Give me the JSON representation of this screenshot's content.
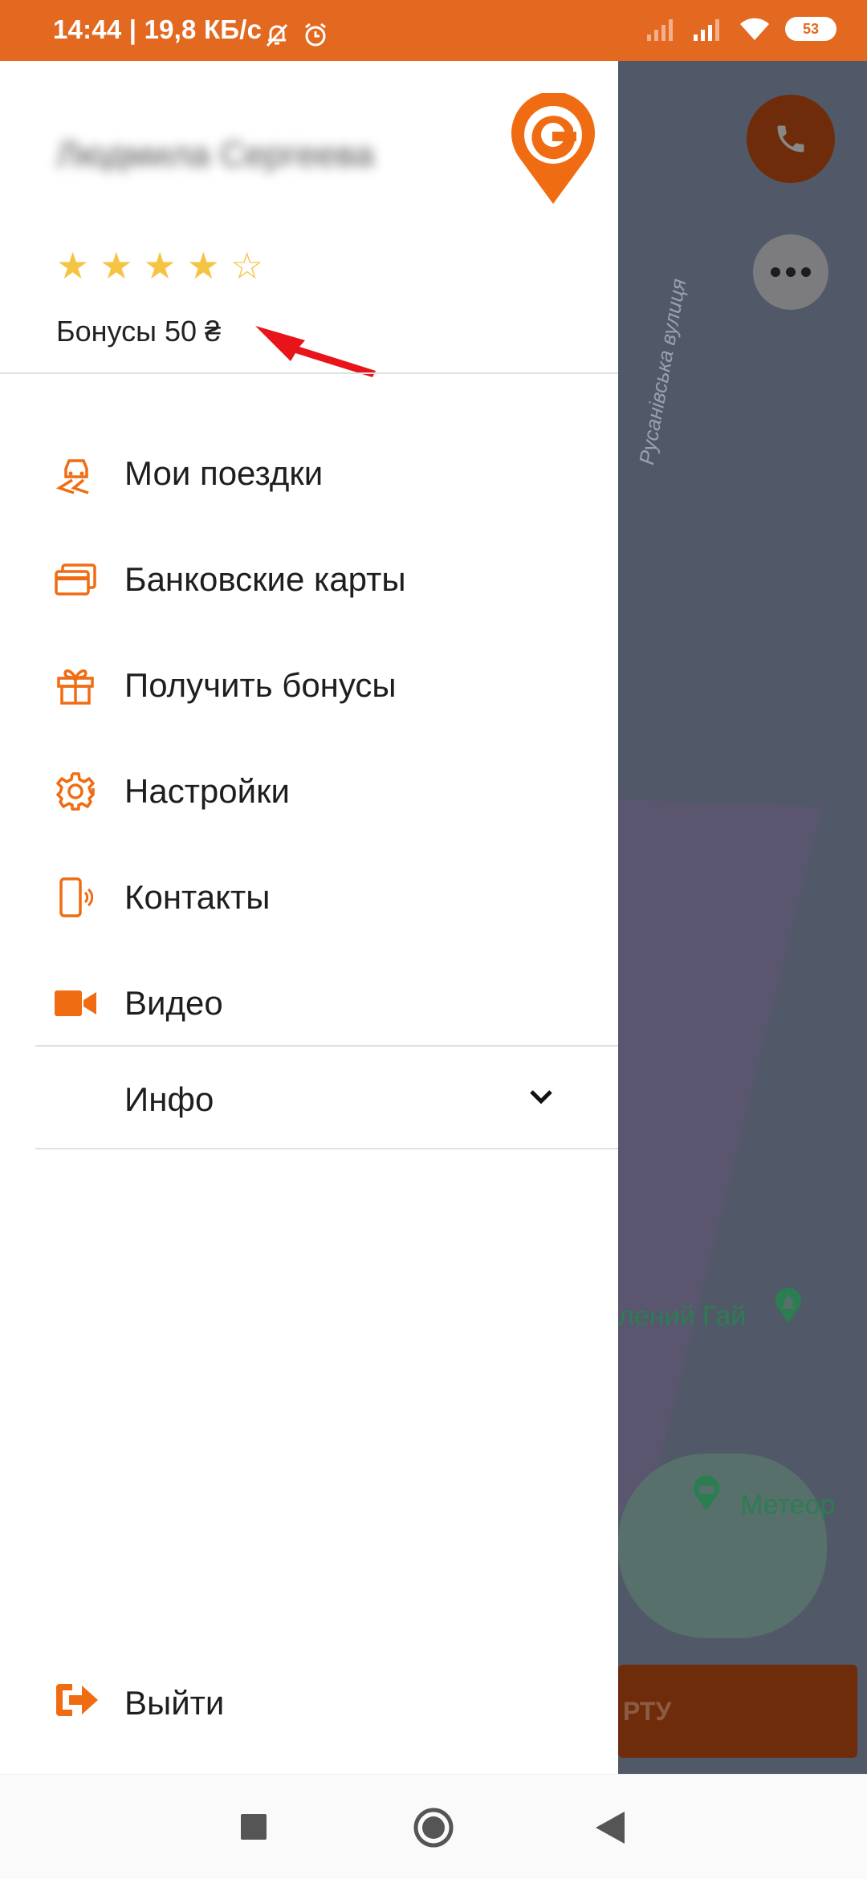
{
  "status_bar": {
    "time_speed": "14:44 | 19,8 КБ/с",
    "battery": "53",
    "icons": [
      "mute-bell-icon",
      "alarm-icon",
      "signal-icon",
      "signal-icon",
      "wifi-icon",
      "battery-icon"
    ]
  },
  "drawer": {
    "user_name": "Людмила Сергеева",
    "rating": 4,
    "rating_max": 5,
    "bonus_text": "Бонусы 50 ₴",
    "menu": [
      {
        "label": "Мои поездки",
        "icon": "trips-icon"
      },
      {
        "label": "Банковские карты",
        "icon": "card-icon"
      },
      {
        "label": "Получить бонусы",
        "icon": "gift-icon"
      },
      {
        "label": "Настройки",
        "icon": "gear-icon"
      },
      {
        "label": "Контакты",
        "icon": "phone-icon"
      },
      {
        "label": "Видео",
        "icon": "video-icon"
      }
    ],
    "info_label": "Инфо",
    "logout_label": "Выйти"
  },
  "map": {
    "street": "Русанівська вулиця",
    "poi_1": "лений Гай",
    "poi_2": "Метеор",
    "order_button": "РТУ"
  },
  "colors": {
    "accent": "#E2691F",
    "star": "#F6C443",
    "arrow": "#E8141A",
    "map": "#515968"
  }
}
